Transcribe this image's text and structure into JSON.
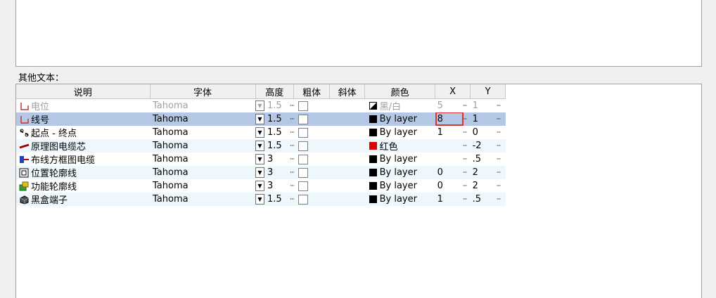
{
  "section_label": "其他文本：",
  "columns": {
    "desc": "说明",
    "font": "字体",
    "height": "高度",
    "bold": "粗体",
    "italic": "斜体",
    "color": "颜色",
    "x": "X",
    "y": "Y"
  },
  "rows": [
    {
      "desc": "电位",
      "font": "Tahoma",
      "height": "1.5",
      "color": "黑/白",
      "x": "5",
      "y": "1",
      "icon": "potential-icon",
      "state": "disabled"
    },
    {
      "desc": "线号",
      "font": "Tahoma",
      "height": "1.5",
      "color": "By layer",
      "x": "8",
      "y": "1",
      "icon": "wire-number-icon",
      "state": "selected"
    },
    {
      "desc": "起点 - 终点",
      "font": "Tahoma",
      "height": "1.5",
      "color": "By layer",
      "x": "1",
      "y": "0",
      "icon": "start-end-icon",
      "state": "normal"
    },
    {
      "desc": "原理图电缆芯",
      "font": "Tahoma",
      "height": "1.5",
      "color": "红色",
      "x": "",
      "y": "-2",
      "icon": "cable-core-icon",
      "state": "normal"
    },
    {
      "desc": "布线方框图电缆",
      "font": "Tahoma",
      "height": "3",
      "color": "By layer",
      "x": "",
      "y": ".5",
      "icon": "routing-cable-icon",
      "state": "normal"
    },
    {
      "desc": "位置轮廓线",
      "font": "Tahoma",
      "height": "3",
      "color": "By layer",
      "x": "0",
      "y": "2",
      "icon": "location-outline-icon",
      "state": "normal"
    },
    {
      "desc": "功能轮廓线",
      "font": "Tahoma",
      "height": "3",
      "color": "By layer",
      "x": "0",
      "y": "2",
      "icon": "function-outline-icon",
      "state": "normal"
    },
    {
      "desc": "黑盒端子",
      "font": "Tahoma",
      "height": "1.5",
      "color": "By layer",
      "x": "1",
      "y": ".5",
      "icon": "blackbox-terminal-icon",
      "state": "normal"
    }
  ],
  "colors": {
    "red": "#e00000",
    "selected": "#b4c8e6",
    "alt_row": "#eef7fb"
  }
}
